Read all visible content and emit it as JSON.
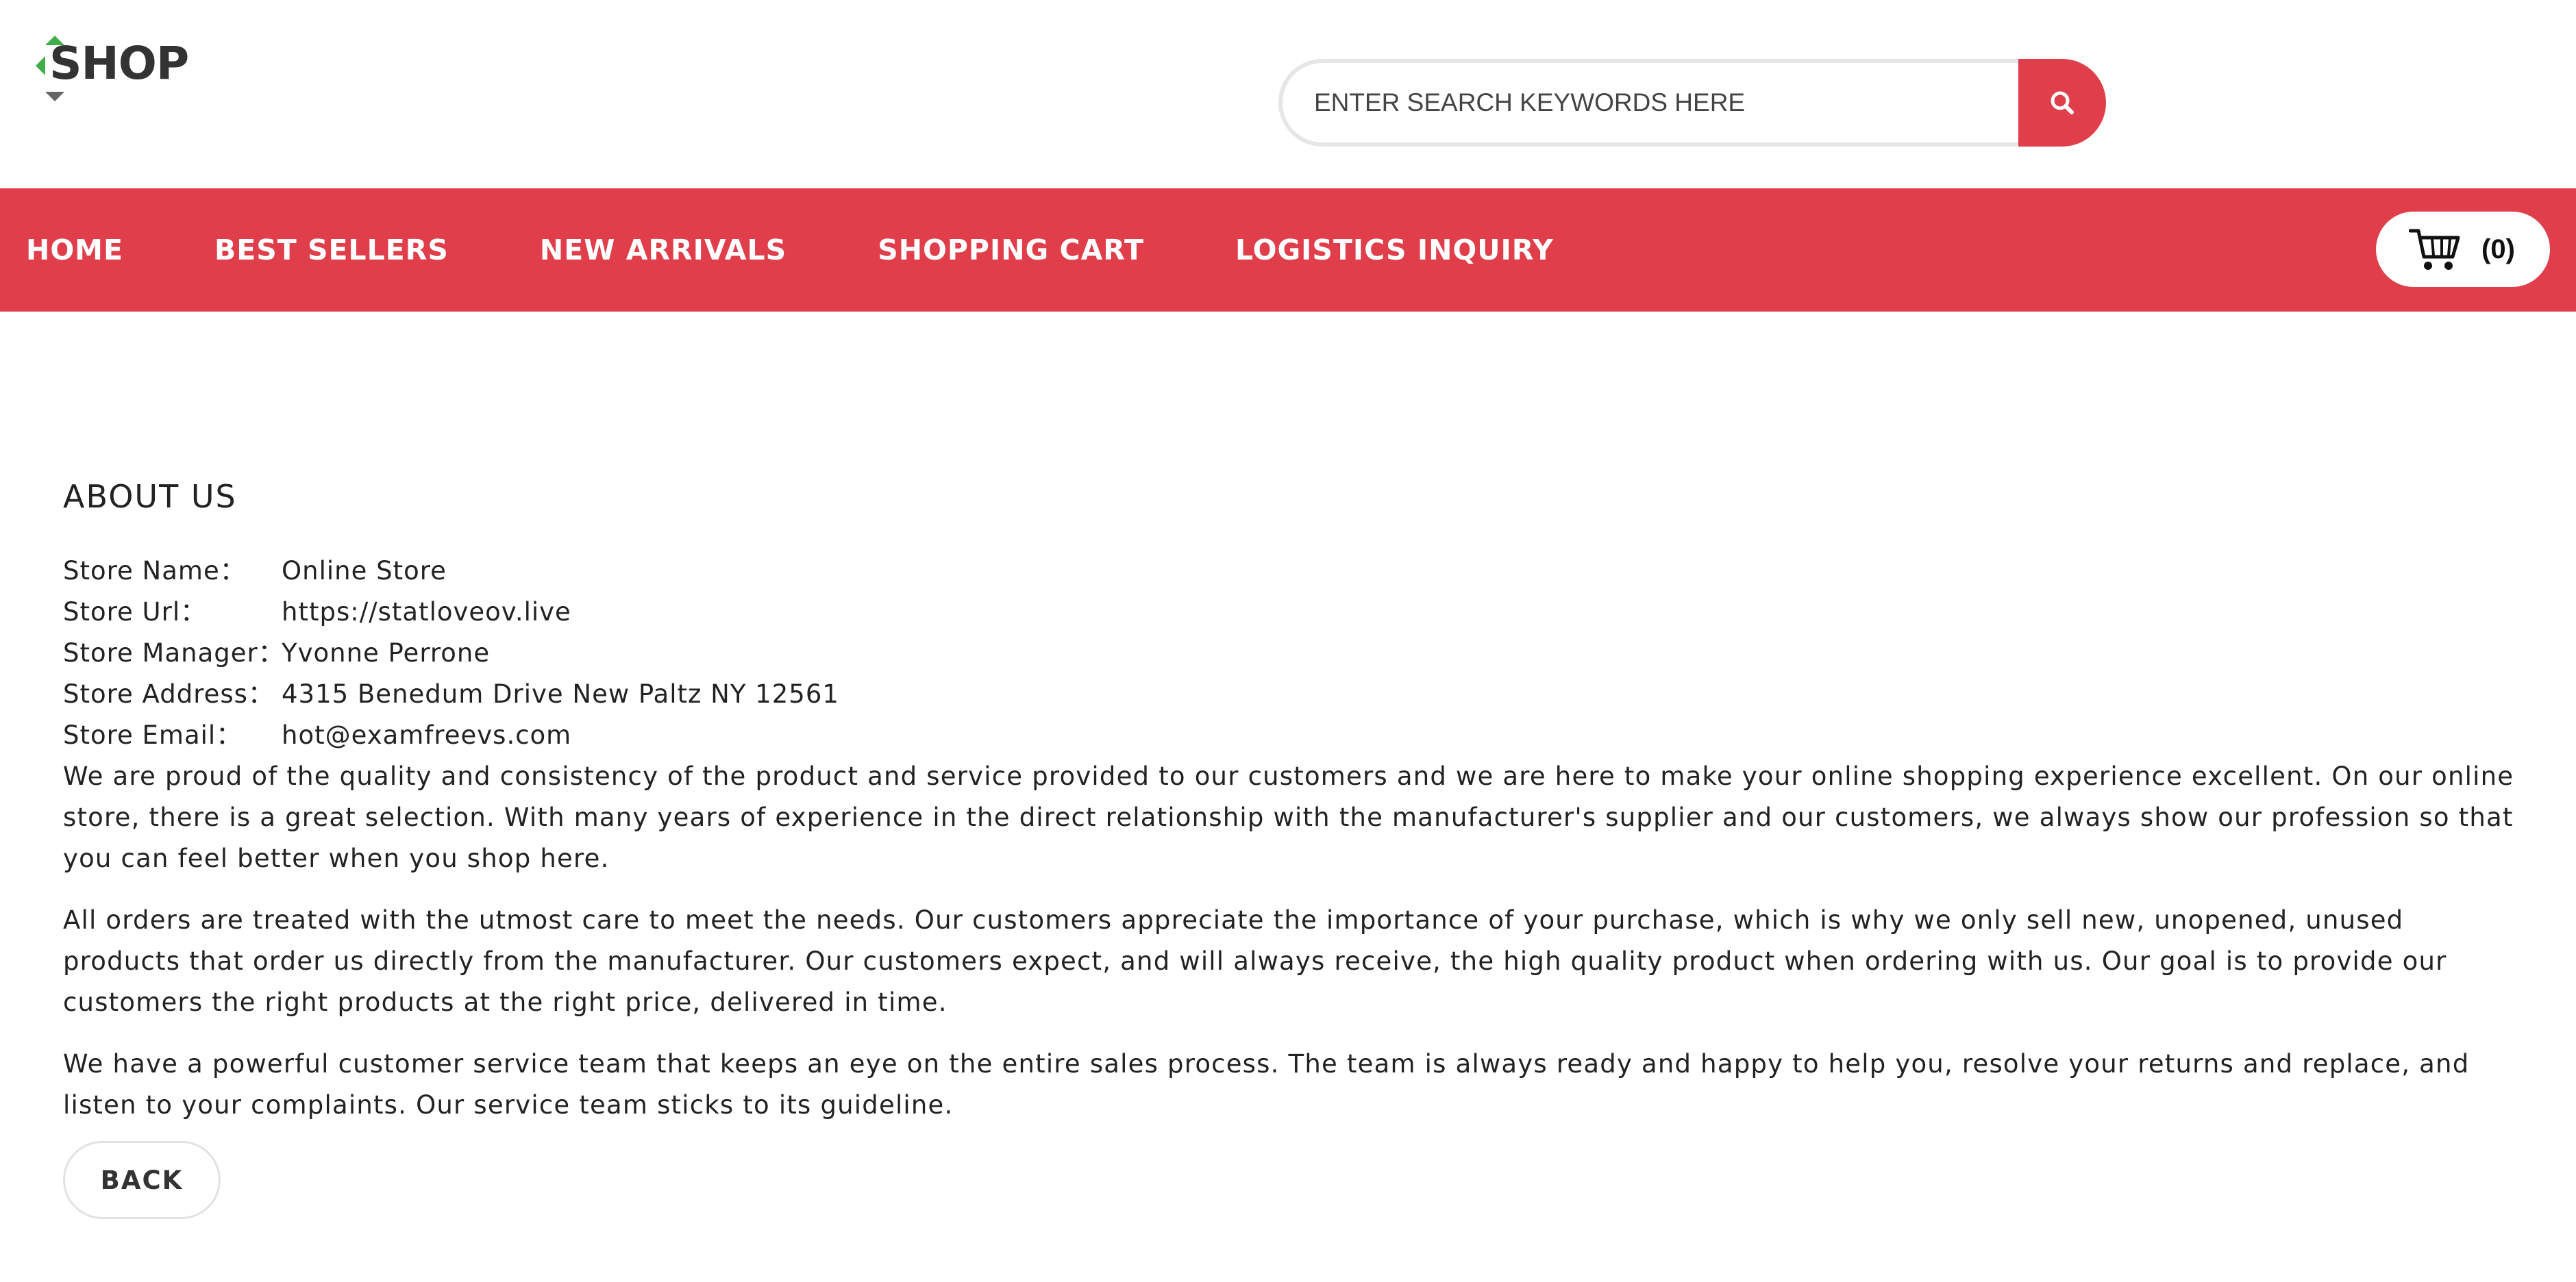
{
  "brand": {
    "logo_text": "SHOP",
    "logo_colors": {
      "green": "#3fae49",
      "gray": "#666666",
      "text": "#333333"
    }
  },
  "search": {
    "placeholder": "ENTER SEARCH KEYWORDS HERE",
    "icon": "search-icon"
  },
  "theme": {
    "accent": "#df3e4a",
    "nav_text": "#ffffff"
  },
  "nav": {
    "items": [
      {
        "label": "HOME"
      },
      {
        "label": "BEST SELLERS"
      },
      {
        "label": "NEW ARRIVALS"
      },
      {
        "label": "SHOPPING CART"
      },
      {
        "label": "LOGISTICS INQUIRY"
      }
    ],
    "cart": {
      "icon": "cart-icon",
      "count_label": "(0)"
    }
  },
  "about": {
    "title": "ABOUT US",
    "info": [
      {
        "label": "Store Name：",
        "value": "Online Store"
      },
      {
        "label": "Store Url：",
        "value": "https://statloveov.live"
      },
      {
        "label": "Store Manager：",
        "value": "Yvonne Perrone"
      },
      {
        "label": "Store Address：",
        "value": "4315 Benedum Drive New Paltz NY 12561"
      },
      {
        "label": "Store Email：",
        "value": "hot@examfreevs.com"
      }
    ],
    "paragraphs": [
      "We are proud of the quality and consistency of the product and service provided to our customers and we are here to make your online shopping experience excellent. On our online store, there is a great selection. With many years of experience in the direct relationship with the manufacturer's supplier and our customers, we always show our profession so that you can feel better when you shop here.",
      "All orders are treated with the utmost care to meet the needs. Our customers appreciate the importance of your purchase, which is why we only sell new, unopened, unused products that order us directly from the manufacturer. Our customers expect, and will always receive, the high quality product when ordering with us. Our goal is to provide our customers the right products at the right price, delivered in time.",
      "We have a powerful customer service team that keeps an eye on the entire sales process. The team is always ready and happy to help you, resolve your returns and replace, and listen to your complaints. Our service team sticks to its guideline."
    ],
    "back_label": "BACK"
  }
}
